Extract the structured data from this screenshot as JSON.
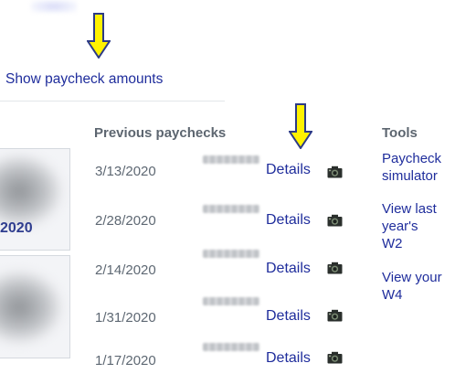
{
  "header": {
    "show_amounts_label": "Show paycheck amounts"
  },
  "year_cards": [
    {
      "year": "2020"
    },
    {
      "year": ""
    }
  ],
  "paychecks": {
    "heading": "Previous paychecks",
    "rows": [
      {
        "date": "3/13/2020",
        "details_label": "Details"
      },
      {
        "date": "2/28/2020",
        "details_label": "Details"
      },
      {
        "date": "2/14/2020",
        "details_label": "Details"
      },
      {
        "date": "1/31/2020",
        "details_label": "Details"
      },
      {
        "date": "1/17/2020",
        "details_label": "Details"
      }
    ]
  },
  "tools": {
    "heading": "Tools",
    "links": [
      {
        "label_lines": [
          "Paycheck",
          "simulator"
        ]
      },
      {
        "label_lines": [
          "View last",
          "year's",
          "W2"
        ]
      },
      {
        "label_lines": [
          "View your",
          "W4"
        ]
      }
    ]
  },
  "icons": {
    "camera": "camera-icon",
    "arrow": "arrow-down-icon"
  },
  "colors": {
    "link": "#1f2d9c",
    "arrow_fill": "#fff200",
    "arrow_stroke": "#2c3a86"
  }
}
